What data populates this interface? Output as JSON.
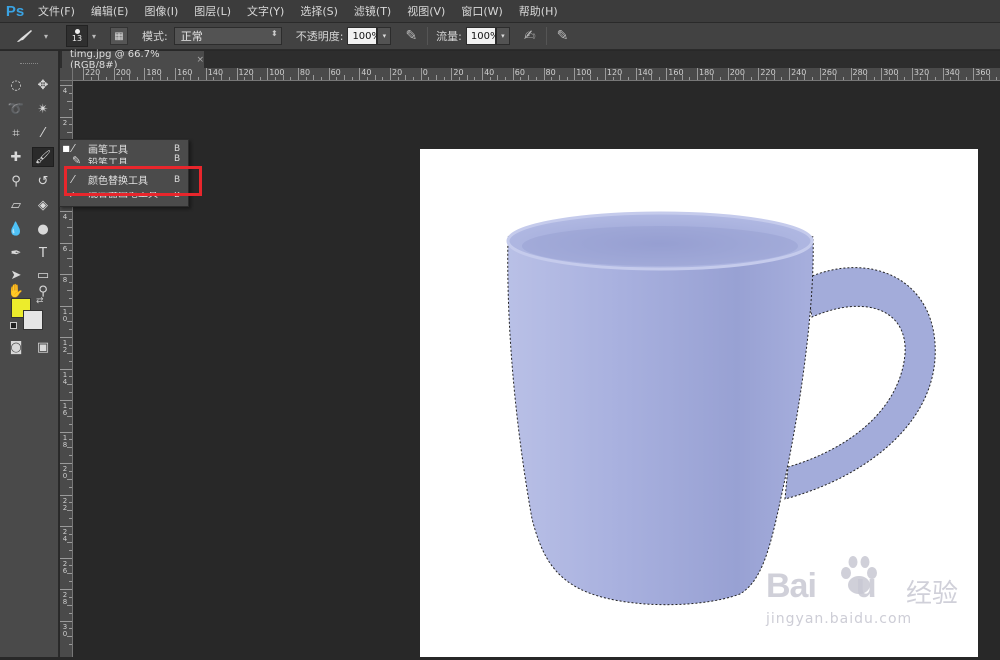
{
  "app": {
    "logo": "Ps"
  },
  "menu": [
    "文件(F)",
    "编辑(E)",
    "图像(I)",
    "图层(L)",
    "文字(Y)",
    "选择(S)",
    "滤镜(T)",
    "视图(V)",
    "窗口(W)",
    "帮助(H)"
  ],
  "options": {
    "brush_size": "13",
    "mode_label": "模式:",
    "mode_value": "正常",
    "opacity_label": "不透明度:",
    "opacity_value": "100%",
    "flow_label": "流量:",
    "flow_value": "100%"
  },
  "document": {
    "tab_title": "timg.jpg @ 66.7%(RGB/8#)",
    "close": "×"
  },
  "ruler_h": [
    "220",
    "200",
    "180",
    "160",
    "140",
    "120",
    "100",
    "80",
    "60",
    "40",
    "20",
    "0",
    "20",
    "40",
    "60",
    "80",
    "100",
    "120",
    "140",
    "160",
    "180",
    "200",
    "220",
    "240",
    "260",
    "280",
    "300",
    "320",
    "340",
    "360"
  ],
  "ruler_v": [
    "4",
    "2",
    "0",
    "2",
    "4",
    "6",
    "8",
    "10",
    "12",
    "14",
    "16",
    "18",
    "20",
    "22",
    "24",
    "26",
    "28",
    "30"
  ],
  "flyout": {
    "items": [
      {
        "mark": "■",
        "label": "画笔工具",
        "key": "B"
      },
      {
        "mark": "",
        "label": "铅笔工具",
        "key": "B"
      },
      {
        "mark": "",
        "label": "颜色替换工具",
        "key": "B"
      },
      {
        "mark": "",
        "label": "混合器画笔工具",
        "key": "B"
      }
    ]
  },
  "colors": {
    "foreground": "#ecec2c",
    "background": "#e6e6e6",
    "highlight": "#e8262c",
    "mug": "#a3acd8"
  },
  "watermark": {
    "brand": "Bai",
    "brand2": "u",
    "jingyan": "经验",
    "url": "jingyan.baidu.com"
  }
}
